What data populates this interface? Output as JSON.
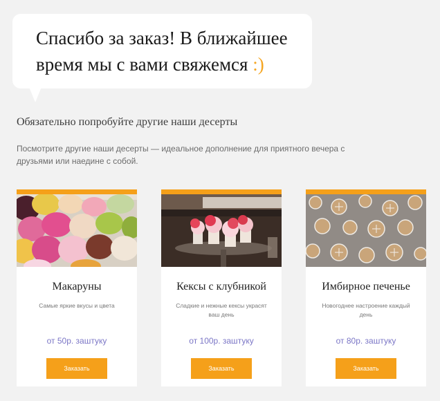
{
  "bubble": {
    "text": "Спасибо за заказ! В ближайшее время мы с вами свяжемся",
    "smile": ":)"
  },
  "section": {
    "title": "Обязательно попробуйте другие наши десерты",
    "description": "Посмотрите другие наши десерты — идеальное дополнение для приятного вечера с друзьями или наедине с собой."
  },
  "cards": [
    {
      "name": "Макаруны",
      "description": "Самые яркие вкусы и цвета",
      "price": "от 50р. заштуку",
      "button": "Заказать"
    },
    {
      "name": "Кексы с клубникой",
      "description": "Сладкие и нежные кексы украсят ваш день",
      "price": "от 100р. заштуку",
      "button": "Заказать"
    },
    {
      "name": "Имбирное печенье",
      "description": "Новогоднее настроение каждый день",
      "price": "от 80р. заштуку",
      "button": "Заказать"
    }
  ],
  "colors": {
    "accent": "#f5a01a",
    "price": "#7b76c6",
    "background": "#f2f2f2"
  }
}
